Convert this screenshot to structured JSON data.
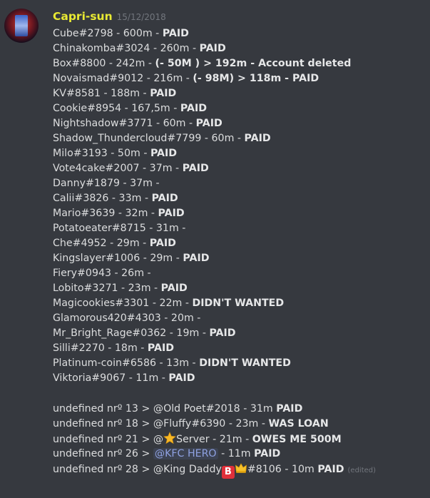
{
  "message": {
    "author": "Capri-sun",
    "timestamp": "15/12/2018",
    "list": [
      {
        "text": "Cube#2798 - 600m - ",
        "status": "PAID"
      },
      {
        "text": "Chinakomba#3024 - 260m - ",
        "status": " PAID"
      },
      {
        "text": "Box#8800 - 242m - ",
        "status": "(- 50M ) > 192m - Account deleted"
      },
      {
        "text": "Novaismad#9012 - 216m - ",
        "status": " (- 98M) > 118m - PAID"
      },
      {
        "text": "KV#8581 - 188m - ",
        "status": "PAID"
      },
      {
        "text": "Cookie#8954 - 167,5m - ",
        "status": "PAID"
      },
      {
        "text": "Nightshadow#3771 - 60m - ",
        "status": "PAID"
      },
      {
        "text": "Shadow_Thundercloud#7799 - 60m - ",
        "status": "PAID"
      },
      {
        "text": "Milo#3193 - 50m - ",
        "status": "PAID"
      },
      {
        "text": "Vote4cake#2007 - 37m - ",
        "status": "PAID"
      },
      {
        "text": "Danny#1879 - 37m - ",
        "status": ""
      },
      {
        "text": "Calii#3826 - 33m - ",
        "status": "PAID"
      },
      {
        "text": "Mario#3639 - 32m - ",
        "status": "PAID"
      },
      {
        "text": "Potatoeater#8715 - 31m - ",
        "status": ""
      },
      {
        "text": "Che#4952 - 29m - ",
        "status": "PAID"
      },
      {
        "text": "Kingslayer#1006 - 29m - ",
        "status": "PAID"
      },
      {
        "text": "Fiery#0943 - 26m - ",
        "status": ""
      },
      {
        "text": "Lobito#3271 - 23m - ",
        "status": "PAID"
      },
      {
        "text": "Magicookies#3301 - 22m - ",
        "status": "DIDN'T WANTED"
      },
      {
        "text": "Glamorous420#4303 - 20m - ",
        "status": ""
      },
      {
        "text": "Mr_Bright_Rage#0362 - 19m - ",
        "status": "PAID"
      },
      {
        "text": "Silli#2270 - 18m - ",
        "status": "PAID"
      },
      {
        "text": "Platinum-coin#6586 - 13m - ",
        "status": "DIDN'T WANTED"
      },
      {
        "text": "Viktoria#9067 - 11m - ",
        "status": "PAID"
      }
    ],
    "undefined_lines": {
      "l13": {
        "prefix": "undefined nrº 13 > ",
        "mention": "@Old Poet#2018",
        "suffix": " - 31m ",
        "status": "PAID"
      },
      "l18": {
        "prefix": "undefined nrº 18 > ",
        "mention": " @Fluffy#6390",
        "suffix": " - 23m - ",
        "status": "WAS LOAN"
      },
      "l21": {
        "prefix": "undefined nrº 21 > ",
        "mention_a": "@",
        "emoji": "star",
        "mention_b": "Server",
        "suffix": " - 21m - ",
        "status": "OWES ME 500M"
      },
      "l26": {
        "prefix": "undefined nrº 26 > ",
        "mention": "@KFC HERO",
        "suffix": " - 11m ",
        "status": "PAID"
      },
      "l28": {
        "prefix": "undefined nrº 28 > ",
        "mention_a": "@King Daddy",
        "b_emoji": "B",
        "emoji": "crown",
        "mention_b": "#8106",
        "suffix": " - 10m ",
        "status": "PAID",
        "edited": "(edited)"
      }
    }
  },
  "colors": {
    "background": "#36393f",
    "username": "#e9ea33",
    "text": "#dcddde",
    "mention": "#8ea1e1"
  }
}
